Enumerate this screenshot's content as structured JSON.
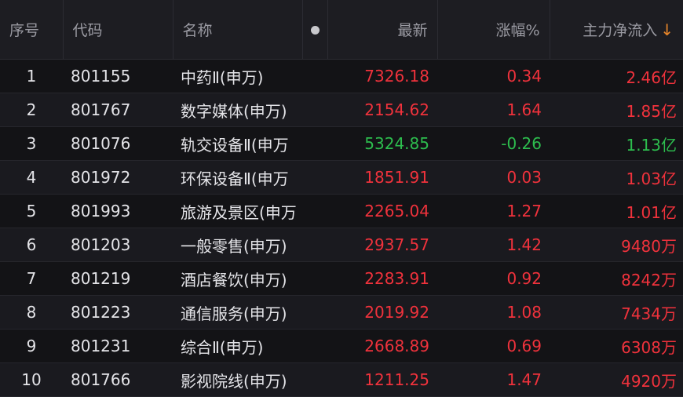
{
  "colors": {
    "up": "#f0323c",
    "down": "#2dbd4e",
    "sort_arrow": "#e8862a"
  },
  "header": {
    "index": "序号",
    "code": "代码",
    "name": "名称",
    "latest": "最新",
    "change_pct": "涨幅%",
    "main_inflow": "主力净流入",
    "sort_arrow": "↓"
  },
  "rows": [
    {
      "index": "1",
      "code": "801155",
      "name": "中药Ⅱ(申万)",
      "latest": "7326.18",
      "change": "0.34",
      "inflow": "2.46亿",
      "dir": "up"
    },
    {
      "index": "2",
      "code": "801767",
      "name": "数字媒体(申万)",
      "latest": "2154.62",
      "change": "1.64",
      "inflow": "1.85亿",
      "dir": "up"
    },
    {
      "index": "3",
      "code": "801076",
      "name": "轨交设备Ⅱ(申万",
      "latest": "5324.85",
      "change": "-0.26",
      "inflow": "1.13亿",
      "dir": "down"
    },
    {
      "index": "4",
      "code": "801972",
      "name": "环保设备Ⅱ(申万",
      "latest": "1851.91",
      "change": "0.03",
      "inflow": "1.03亿",
      "dir": "up"
    },
    {
      "index": "5",
      "code": "801993",
      "name": "旅游及景区(申万",
      "latest": "2265.04",
      "change": "1.27",
      "inflow": "1.01亿",
      "dir": "up"
    },
    {
      "index": "6",
      "code": "801203",
      "name": "一般零售(申万)",
      "latest": "2937.57",
      "change": "1.42",
      "inflow": "9480万",
      "dir": "up"
    },
    {
      "index": "7",
      "code": "801219",
      "name": "酒店餐饮(申万)",
      "latest": "2283.91",
      "change": "0.92",
      "inflow": "8242万",
      "dir": "up"
    },
    {
      "index": "8",
      "code": "801223",
      "name": "通信服务(申万)",
      "latest": "2019.92",
      "change": "1.08",
      "inflow": "7434万",
      "dir": "up"
    },
    {
      "index": "9",
      "code": "801231",
      "name": "综合Ⅱ(申万)",
      "latest": "2668.89",
      "change": "0.69",
      "inflow": "6308万",
      "dir": "up"
    },
    {
      "index": "10",
      "code": "801766",
      "name": "影视院线(申万)",
      "latest": "1211.25",
      "change": "1.47",
      "inflow": "4920万",
      "dir": "up"
    }
  ]
}
